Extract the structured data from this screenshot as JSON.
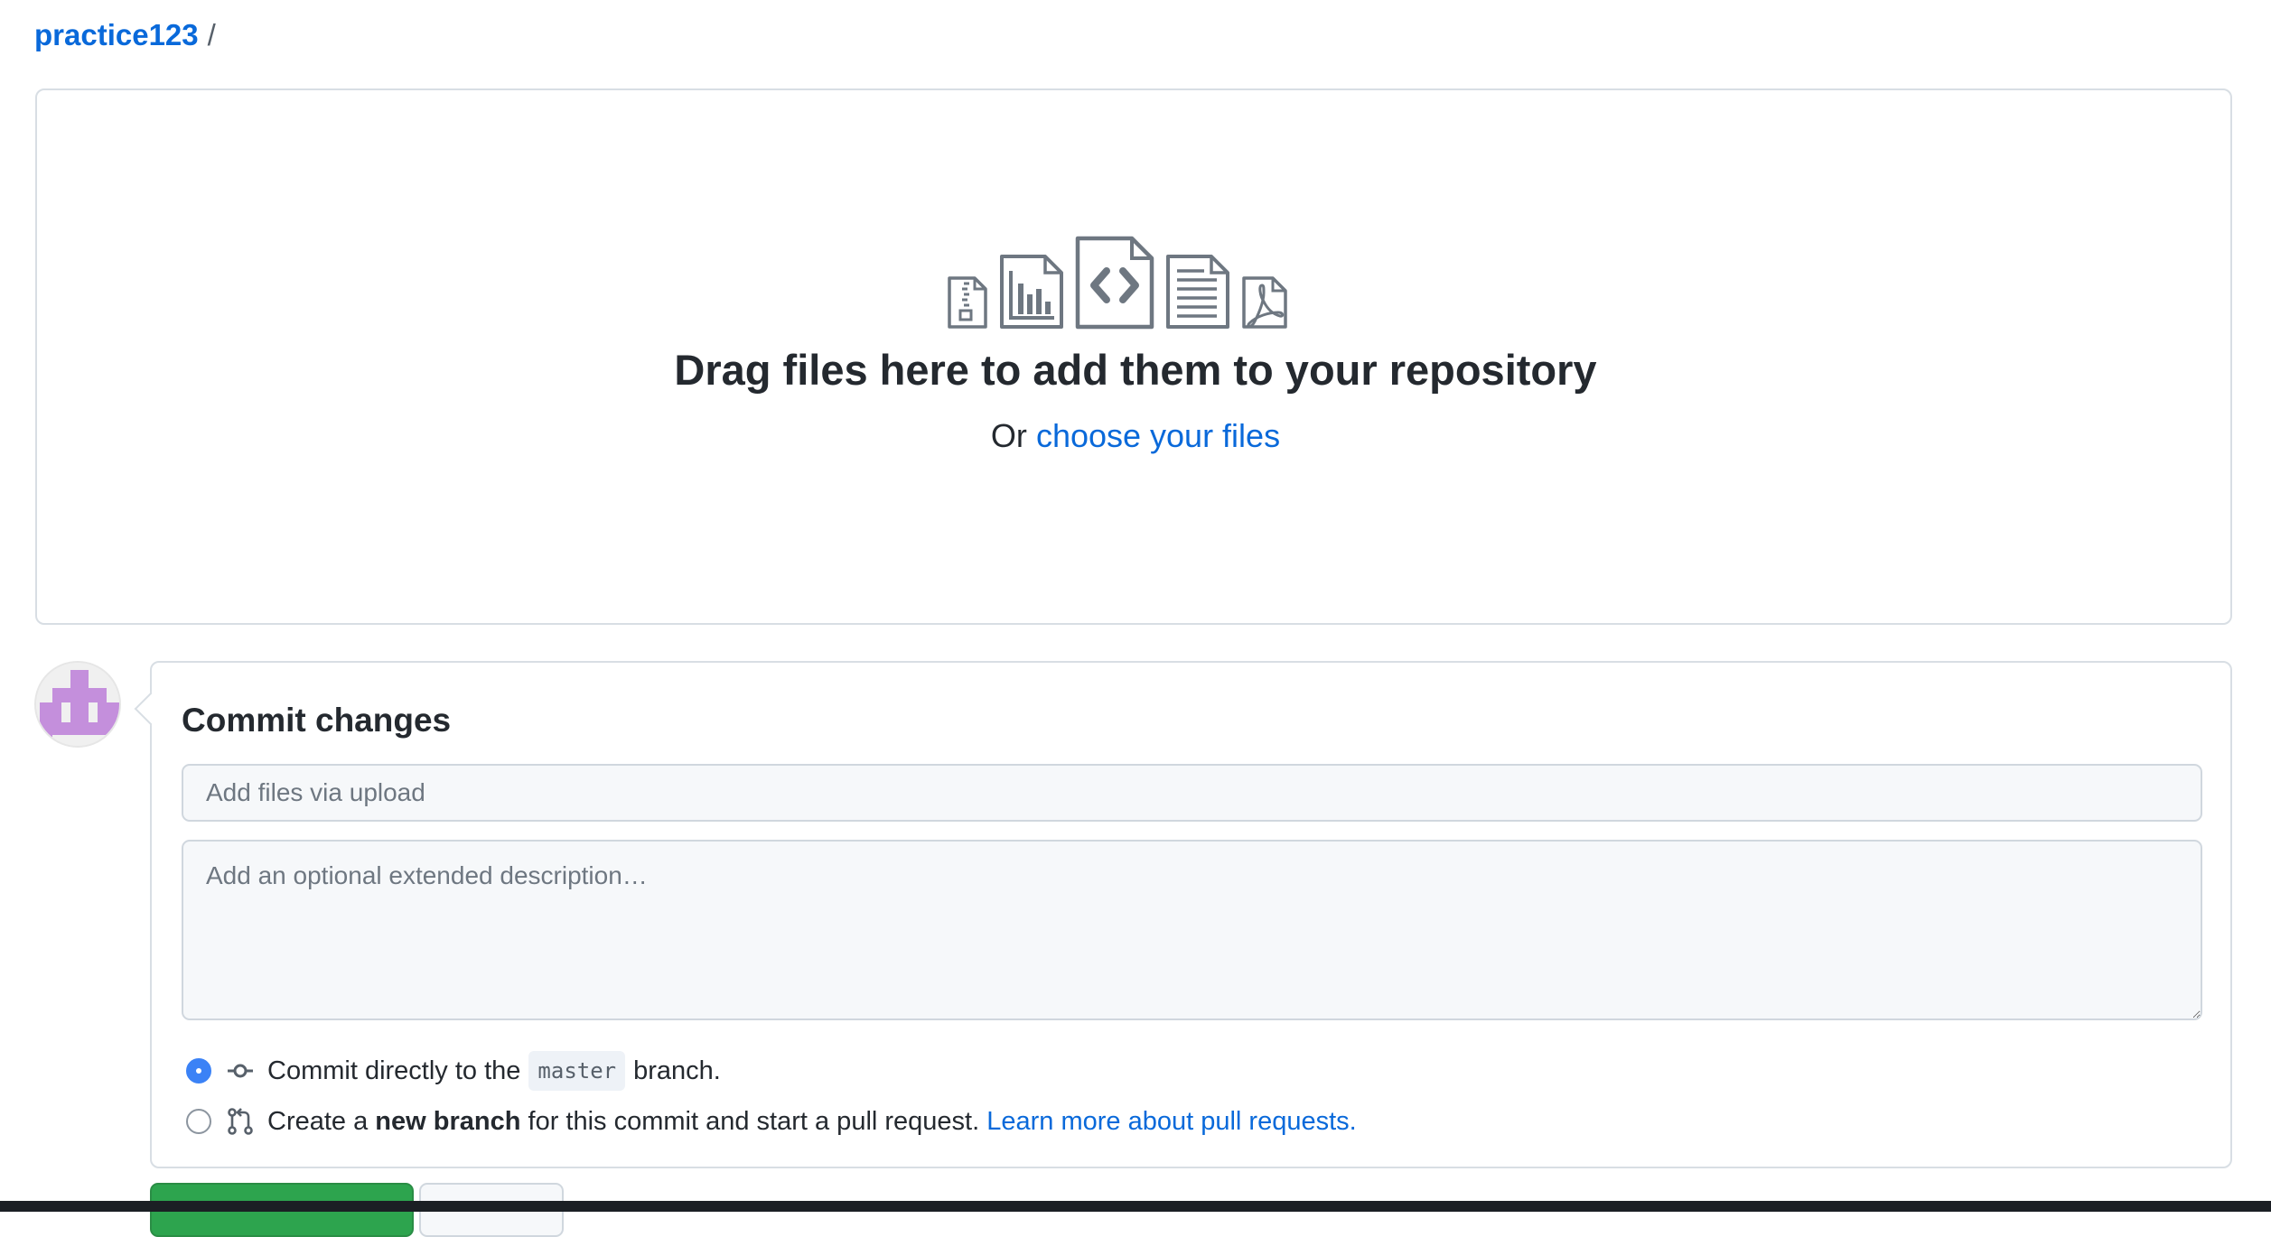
{
  "breadcrumb": {
    "repo": "practice123",
    "separator": "/"
  },
  "dropzone": {
    "title": "Drag files here to add them to your repository",
    "prefix": "Or",
    "link": "choose your files",
    "icons": [
      "file-zip-icon",
      "file-chart-icon",
      "file-code-icon",
      "file-text-icon",
      "file-pdf-icon"
    ]
  },
  "commit": {
    "title": "Commit changes",
    "summary_placeholder": "Add files via upload",
    "description_placeholder": "Add an optional extended description…",
    "option_direct": {
      "before": "Commit directly to the",
      "branch": "master",
      "after": "branch.",
      "checked": true,
      "icon": "git-commit-icon"
    },
    "option_new_branch": {
      "before": "Create a",
      "bold": "new branch",
      "after": "for this commit and start a pull request.",
      "link": "Learn more about pull requests.",
      "checked": false,
      "icon": "git-pull-request-icon"
    },
    "commit_button": "",
    "cancel_button": ""
  },
  "colors": {
    "link": "#0969da",
    "primary_button": "#2da44e",
    "radio_checked": "#3b82f6",
    "avatar": "#c48fdc"
  }
}
